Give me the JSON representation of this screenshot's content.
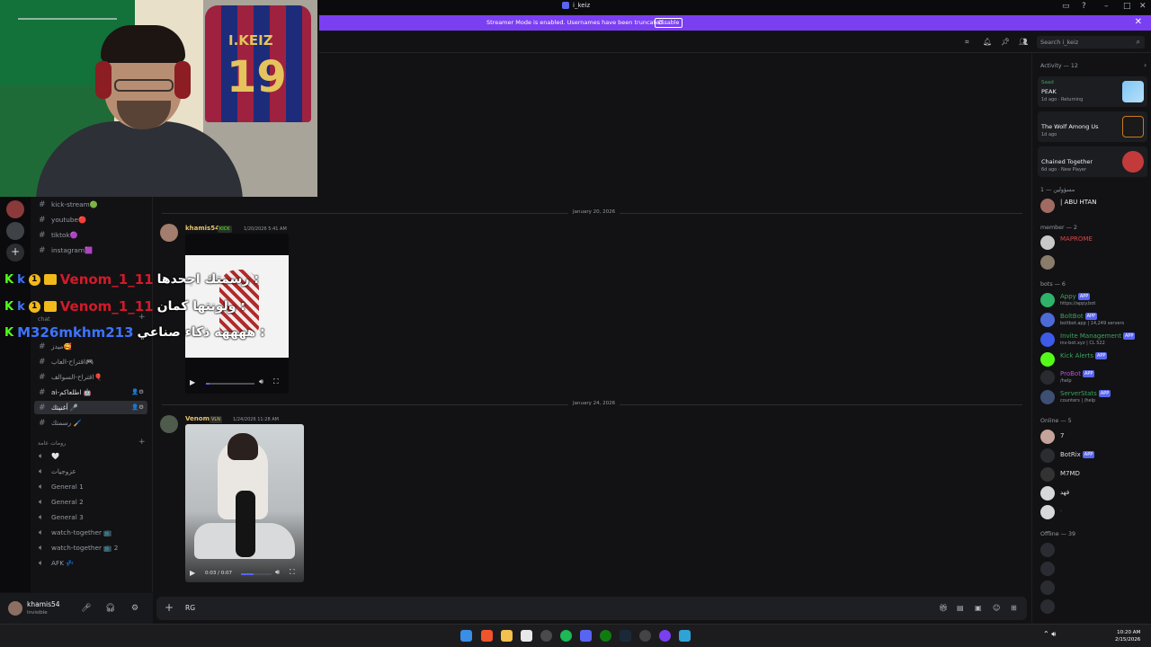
{
  "window": {
    "title": "i_keiz"
  },
  "banner": {
    "text": "Streamer Mode is enabled. Usernames have been truncated.",
    "disable_label": "Disable"
  },
  "header": {
    "search_placeholder": "Search i_keiz"
  },
  "webcam": {
    "jersey_name": "I.KEIZ",
    "jersey_number": "19"
  },
  "channels": {
    "items": [
      {
        "label": "kick-stream🟢"
      },
      {
        "label": "youtube🔴"
      },
      {
        "label": "tiktok🟣"
      },
      {
        "label": "instagram🟪"
      }
    ],
    "category_1": "chat",
    "items2": [
      {
        "label": "ميدز🥰"
      },
      {
        "label": "اقتراح-العاب🎮"
      },
      {
        "label": "اقتراح-السوالف🎈"
      },
      {
        "label": "ai-اطلعاكم 🤖"
      },
      {
        "label": "أغنيتك 🎤"
      },
      {
        "label": "رسمتك 🖌️"
      }
    ],
    "category_voice": "رومات عامة",
    "voice": [
      {
        "label": "🤍"
      },
      {
        "label": "عزوجيات"
      },
      {
        "label": "General 1"
      },
      {
        "label": "General 2"
      },
      {
        "label": "General 3"
      },
      {
        "label": "watch-together 📺"
      },
      {
        "label": "watch-together 📺 2"
      },
      {
        "label": "AFK 💤"
      }
    ]
  },
  "overlay_chat": [
    {
      "user": "Venom_1_11",
      "text": "رسمتك اجحدها :"
    },
    {
      "user": "Venom_1_11",
      "text": "ولونتها كمان :"
    },
    {
      "user": "M326mkhm213",
      "text": "ههههه ذكاء صناعي :"
    }
  ],
  "messages": {
    "date1": "January 20, 2026",
    "msg1": {
      "author": "khamis54",
      "badge": "KICK",
      "time": "1/20/2026 5:41 AM"
    },
    "date2": "January 24, 2026",
    "msg2": {
      "author": "Venom",
      "badge": "VLN",
      "time": "1/24/2026 11:28 AM",
      "video_time": "0:03 / 0:07"
    }
  },
  "composer": {
    "text": "RG"
  },
  "user_panel": {
    "name": "khamis54",
    "status": "Invisible"
  },
  "members": {
    "activity_header": "Activity — 12",
    "activities": [
      {
        "user": "Saad",
        "title": "PEAK",
        "meta": "1d ago · Returning"
      },
      {
        "user": "",
        "title": "The Wolf Among Us",
        "meta": "1d ago"
      },
      {
        "user": "",
        "title": "Chained Together",
        "meta": "6d ago · New Player"
      }
    ],
    "group_admin": "مسؤولين — 1",
    "admin_name": "| ABU HTAN",
    "group_member": "member — 2",
    "member1": "MAPROME",
    "group_bots": "bots — 6",
    "bots": [
      {
        "name": "Appy",
        "sub": "https://appy.bot"
      },
      {
        "name": "BoltBot",
        "sub": "boltbot.app | 14,249 servers"
      },
      {
        "name": "Invite Management",
        "sub": "inv-bot.xyz | CL 522"
      },
      {
        "name": "Kick Alerts",
        "sub": ""
      },
      {
        "name": "ProBot",
        "sub": "/help"
      },
      {
        "name": "ServerStats",
        "sub": "counters | /help"
      }
    ],
    "app_tag": "APP",
    "group_online": "Online — 5",
    "online": [
      "7",
      "BotRix",
      "M7MD",
      "فهد",
      "·"
    ],
    "group_offline": "Offline — 39"
  },
  "taskbar": {
    "time": "10:20 AM",
    "date": "2/15/2026"
  }
}
